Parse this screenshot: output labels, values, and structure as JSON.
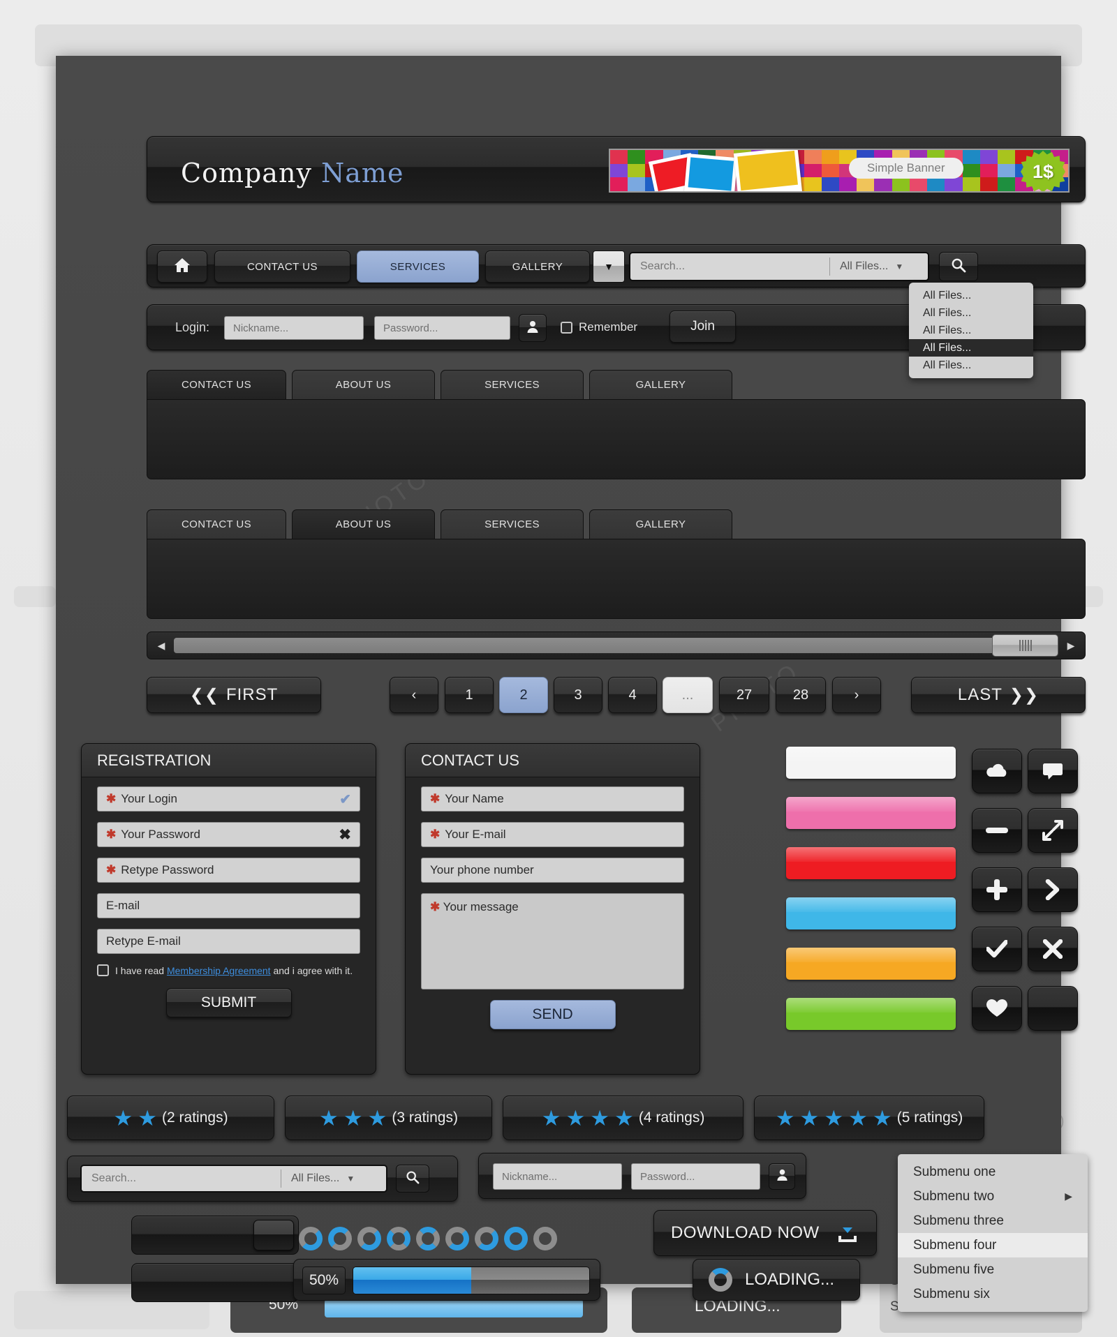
{
  "brand": {
    "word1": "Company",
    "word2": "Name"
  },
  "banner": {
    "label": "Simple Banner",
    "price": "1$"
  },
  "nav": {
    "home_icon": "home-icon",
    "items": [
      "CONTACT US",
      "SERVICES",
      "GALLERY"
    ],
    "active": "SERVICES",
    "caret": "▼"
  },
  "search": {
    "placeholder": "Search...",
    "filter_value": "All Files...",
    "caret": "▼",
    "icon": "search-icon"
  },
  "dropdown": {
    "options": [
      "All Files...",
      "All Files...",
      "All Files...",
      "All Files...",
      "All Files..."
    ],
    "selected_index": 3
  },
  "login": {
    "label": "Login:",
    "nickname_placeholder": "Nickname...",
    "password_placeholder": "Password...",
    "user_icon": "user-icon",
    "remember_label": "Remember",
    "join_label": "Join"
  },
  "tabs_top": {
    "items": [
      "CONTACT US",
      "ABOUT US",
      "SERVICES",
      "GALLERY"
    ],
    "active_index": 0
  },
  "tabs_bottom": {
    "items": [
      "CONTACT US",
      "ABOUT US",
      "SERVICES",
      "GALLERY"
    ],
    "active_index": 1
  },
  "scrollbar": {
    "left_arrow": "◀",
    "right_arrow": "▶"
  },
  "pagination": {
    "first_label": "FIRST",
    "last_label": "LAST",
    "prev": "‹",
    "next": "›",
    "pages": [
      "1",
      "2",
      "3",
      "4",
      "...",
      "27",
      "28"
    ],
    "active_page": "2"
  },
  "registration": {
    "title": "REGISTRATION",
    "fields": [
      {
        "label": "Your Login",
        "required": true,
        "status": "valid"
      },
      {
        "label": "Your Password",
        "required": true,
        "status": "invalid"
      },
      {
        "label": "Retype Password",
        "required": true,
        "status": "none"
      },
      {
        "label": "E-mail",
        "required": false,
        "status": "none"
      },
      {
        "label": "Retype E-mail",
        "required": false,
        "status": "none"
      }
    ],
    "agree_pre": "I have read ",
    "agree_link": "Membership Agreement",
    "agree_post": " and i agree with it.",
    "submit_label": "SUBMIT",
    "valid_icon": "check-icon",
    "invalid_icon": "cross-icon"
  },
  "contact": {
    "title": "CONTACT US",
    "fields": [
      {
        "label": "Your Name",
        "required": true
      },
      {
        "label": "Your E-mail",
        "required": true
      },
      {
        "label": "Your phone number",
        "required": false
      }
    ],
    "message_label": "Your message",
    "message_required": true,
    "send_label": "SEND"
  },
  "color_bars": [
    {
      "name": "white-bar",
      "color": "#f4f4f4"
    },
    {
      "name": "pink-bar",
      "color": "#ee6fab"
    },
    {
      "name": "red-bar",
      "color": "#ee1c22"
    },
    {
      "name": "blue-bar",
      "color": "#3fb7e8"
    },
    {
      "name": "orange-bar",
      "color": "#f6a823"
    },
    {
      "name": "green-bar",
      "color": "#78c92a"
    }
  ],
  "icon_tiles": [
    "cloud-upload-icon",
    "chat-bubble-icon",
    "minus-icon",
    "expand-icon",
    "plus-icon",
    "chevron-right-icon",
    "check-icon",
    "close-icon",
    "heart-icon",
    "blank-icon"
  ],
  "ratings": [
    {
      "stars": 2,
      "label": "(2 ratings)"
    },
    {
      "stars": 3,
      "label": "(3 ratings)"
    },
    {
      "stars": 4,
      "label": "(4 ratings)"
    },
    {
      "stars": 5,
      "label": "(5 ratings)"
    }
  ],
  "bottom_search": {
    "placeholder": "Search...",
    "filter_value": "All Files...",
    "caret": "▼",
    "icon": "search-icon"
  },
  "bottom_login": {
    "nickname_placeholder": "Nickname...",
    "password_placeholder": "Password...",
    "user_icon": "user-icon"
  },
  "submenu": {
    "items": [
      "Submenu one",
      "Submenu two",
      "Submenu three",
      "Submenu four",
      "Submenu five",
      "Submenu six"
    ],
    "selected_index": 3,
    "arrow_index": 1,
    "arrow": "▶"
  },
  "download": {
    "label": "DOWNLOAD NOW",
    "icon": "download-icon"
  },
  "progress": {
    "percent_label": "50%",
    "percent": 50
  },
  "loading": {
    "label": "LOADING...",
    "icon": "spinner-icon"
  },
  "dots": {
    "count": 9,
    "active": 7
  },
  "accent": {
    "blue": "#2e9bdf",
    "pale_blue": "#8ba3ce",
    "red": "#c0392b",
    "link": "#3e8ede"
  }
}
